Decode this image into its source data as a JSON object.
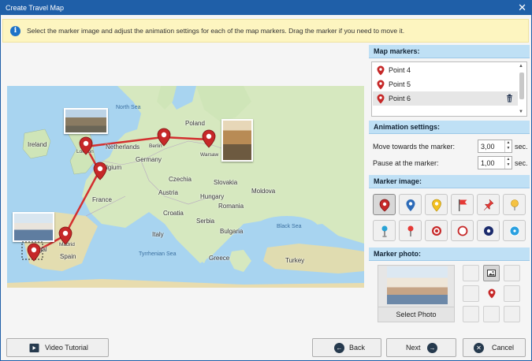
{
  "window": {
    "title": "Create Travel Map",
    "close_glyph": "✕"
  },
  "info": {
    "text": "Select the marker image and adjust the animation settings for each of the map markers. Drag the marker if you need to move it."
  },
  "map": {
    "labels": {
      "north_sea": "North Sea",
      "ireland": "Ireland",
      "london": "London",
      "netherlands": "Netherlands",
      "berlin": "Berlin",
      "poland": "Poland",
      "warsaw": "Warsaw",
      "belgium": "lgium",
      "germany": "Germany",
      "france": "France",
      "czechia": "Czechia",
      "slovakia": "Slovakia",
      "austria": "Austria",
      "hungary": "Hungary",
      "moldova": "Moldova",
      "croatia": "Croatia",
      "romania": "Romania",
      "serbia": "Serbia",
      "italy": "Italy",
      "bulgaria": "Bulgaria",
      "black_sea": "Black Sea",
      "madrid": "Madrid",
      "spain": "Spain",
      "tyrrhenian": "Tyrrhenian Sea",
      "greece": "Greece",
      "turkey": "Turkey",
      "portugal": "gal"
    }
  },
  "markers_panel": {
    "heading": "Map markers:",
    "items": [
      {
        "label": "Point 4"
      },
      {
        "label": "Point 5"
      },
      {
        "label": "Point 6"
      }
    ]
  },
  "animation": {
    "heading": "Animation settings:",
    "move_label": "Move towards the marker:",
    "move_value": "3,00",
    "pause_label": "Pause at the marker:",
    "pause_value": "1,00",
    "unit": "sec."
  },
  "marker_image": {
    "heading": "Marker image:"
  },
  "marker_photo": {
    "heading": "Marker photo:",
    "select_label": "Select Photo"
  },
  "footer": {
    "tutorial_label": "Video Tutorial",
    "back_label": "Back",
    "next_label": "Next",
    "cancel_label": "Cancel"
  },
  "colors": {
    "title_bar": "#1f5fa8",
    "route": "#d32f2f",
    "pin": "#c62828",
    "panel_header": "#bfe0f5",
    "info_bg": "#fdf5c0"
  }
}
